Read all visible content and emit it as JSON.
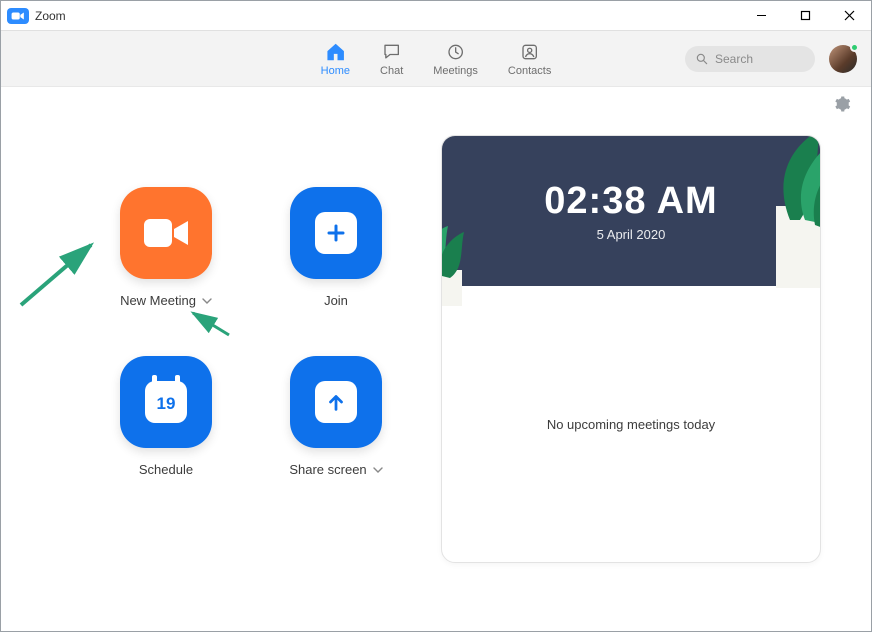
{
  "window": {
    "title": "Zoom"
  },
  "nav": {
    "tabs": [
      {
        "label": "Home",
        "active": true
      },
      {
        "label": "Chat",
        "active": false
      },
      {
        "label": "Meetings",
        "active": false
      },
      {
        "label": "Contacts",
        "active": false
      }
    ],
    "search_placeholder": "Search"
  },
  "actions": {
    "new_meeting": {
      "label": "New Meeting",
      "has_dropdown": true
    },
    "join": {
      "label": "Join",
      "has_dropdown": false
    },
    "schedule": {
      "label": "Schedule",
      "has_dropdown": false,
      "calendar_day": "19"
    },
    "share_screen": {
      "label": "Share screen",
      "has_dropdown": true
    }
  },
  "card": {
    "time": "02:38 AM",
    "date": "5 April 2020",
    "empty_state": "No upcoming meetings today"
  },
  "colors": {
    "brand_blue": "#0E71EB",
    "accent_blue": "#2D8CFF",
    "orange": "#ff742e",
    "hero_bg": "#36415c",
    "arrow": "#2aa37a"
  }
}
